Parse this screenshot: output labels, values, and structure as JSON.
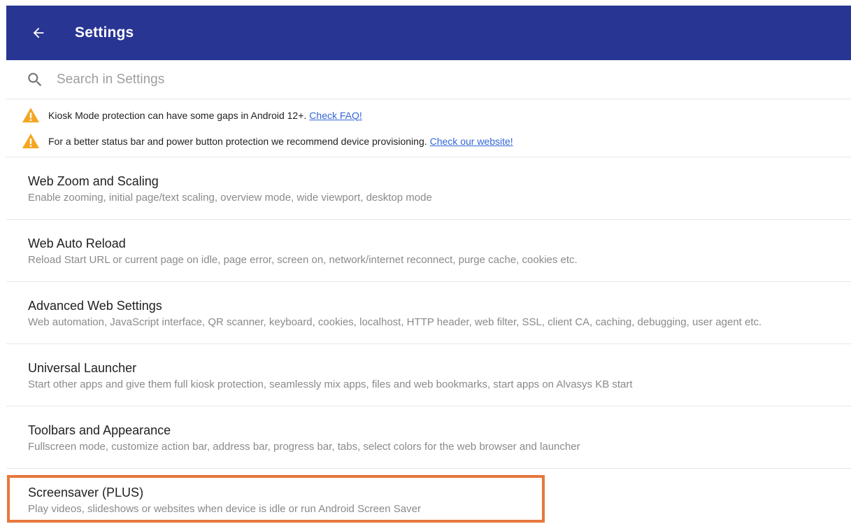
{
  "appbar": {
    "title": "Settings",
    "color": "#283593",
    "back_icon": "arrow-left-icon"
  },
  "search": {
    "placeholder": "Search in Settings",
    "value": ""
  },
  "warnings": [
    {
      "text": "Kiosk Mode protection can have some gaps in Android 12+.",
      "link": "Check FAQ!"
    },
    {
      "text": "For a better status bar and power button protection we recommend device provisioning.",
      "link": "Check our website!"
    }
  ],
  "items": [
    {
      "title": "Web Zoom and Scaling",
      "subtitle": "Enable zooming, initial page/text scaling, overview mode, wide viewport, desktop mode"
    },
    {
      "title": "Web Auto Reload",
      "subtitle": "Reload Start URL or current page on idle, page error, screen on, network/internet reconnect, purge cache, cookies etc."
    },
    {
      "title": "Advanced Web Settings",
      "subtitle": "Web automation, JavaScript interface, QR scanner, keyboard, cookies, localhost, HTTP header, web filter, SSL, client CA, caching, debugging, user agent etc."
    },
    {
      "title": "Universal Launcher",
      "subtitle": "Start other apps and give them full kiosk protection, seamlessly mix apps, files and web bookmarks, start apps on Alvasys KB start"
    },
    {
      "title": "Toolbars and Appearance",
      "subtitle": "Fullscreen mode, customize action bar, address bar, progress bar, tabs, select colors for the web browser and launcher"
    },
    {
      "title": "Screensaver (PLUS)",
      "subtitle": "Play videos, slideshows or websites when device is idle or run Android Screen Saver"
    }
  ],
  "colors": {
    "accent": "#283593",
    "warning": "#f4a623",
    "link": "#3367d6",
    "highlight": "#e8773d"
  }
}
